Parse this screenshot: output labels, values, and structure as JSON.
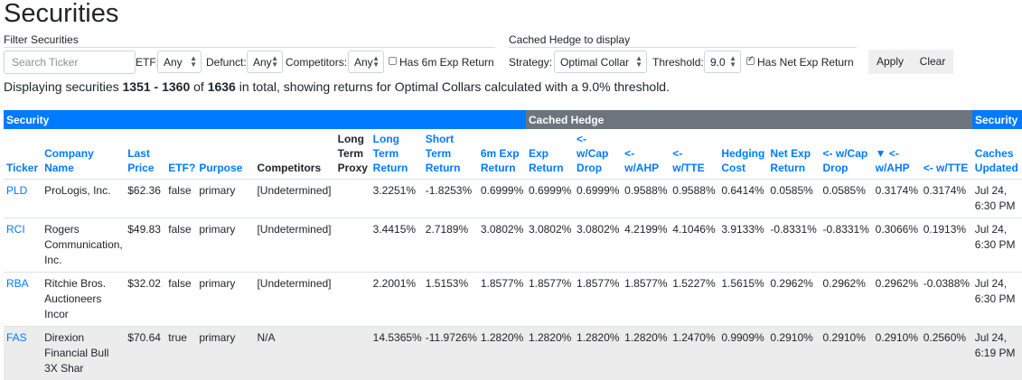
{
  "page_title": "Securities",
  "filter_legend": "Filter Securities",
  "hedge_legend": "Cached Hedge to display",
  "filters": {
    "search_placeholder": "Search Ticker",
    "etf_label": "ETF:",
    "etf_value": "Any",
    "defunct_label": "Defunct:",
    "defunct_value": "Any",
    "competitors_label": "Competitors:",
    "competitors_value": "Any",
    "has6m_label": "Has 6m Exp Return"
  },
  "hedge": {
    "strategy_label": "Strategy:",
    "strategy_value": "Optimal Collar",
    "threshold_label": "Threshold:",
    "threshold_value": "9.0",
    "net_exp_label": "Has Net Exp Return"
  },
  "buttons": {
    "apply": "Apply",
    "clear": "Clear"
  },
  "summary": {
    "prefix": "Displaying securities ",
    "range": "1351 - 1360",
    "of": " of ",
    "total": "1636",
    "suffix": " in total, showing returns for Optimal Collars calculated with a 9.0% threshold."
  },
  "groups": {
    "security": "Security",
    "cached_hedge": "Cached Hedge",
    "security_right": "Security"
  },
  "columns": [
    "Ticker",
    "Company Name",
    "Last Price",
    "ETF?",
    "Purpose",
    "Competitors",
    "Long Term Proxy",
    "Long Term Return",
    "Short Term Return",
    "6m Exp Return",
    "Exp Return",
    "<- w/Cap Drop",
    "<- w/AHP",
    "<- w/TTE",
    "Hedging Cost",
    "Net Exp Return",
    "<- w/Cap Drop",
    "▼ <- w/AHP",
    "<- w/TTE",
    "Caches Updated"
  ],
  "rows": [
    [
      "PLD",
      "ProLogis, Inc.",
      "$62.36",
      "false",
      "primary",
      "[Undetermined]",
      "",
      "3.2251%",
      "-1.8253%",
      "0.6999%",
      "0.6999%",
      "0.6999%",
      "0.9588%",
      "0.9588%",
      "0.6414%",
      "0.0585%",
      "0.0585%",
      "0.3174%",
      "0.3174%",
      "Jul 24, 6:30 PM"
    ],
    [
      "RCI",
      "Rogers Communication, Inc.",
      "$49.83",
      "false",
      "primary",
      "[Undetermined]",
      "",
      "3.4415%",
      "2.7189%",
      "3.0802%",
      "3.0802%",
      "3.0802%",
      "4.2199%",
      "4.1046%",
      "3.9133%",
      "-0.8331%",
      "-0.8331%",
      "0.3066%",
      "0.1913%",
      "Jul 24, 6:30 PM"
    ],
    [
      "RBA",
      "Ritchie Bros. Auctioneers Incor",
      "$32.02",
      "false",
      "primary",
      "[Undetermined]",
      "",
      "2.2001%",
      "1.5153%",
      "1.8577%",
      "1.8577%",
      "1.8577%",
      "1.8577%",
      "1.5227%",
      "1.5615%",
      "0.2962%",
      "0.2962%",
      "0.2962%",
      "-0.0388%",
      "Jul 24, 6:30 PM"
    ],
    [
      "FAS",
      "Direxion Financial Bull 3X Shar",
      "$70.64",
      "true",
      "primary",
      "N/A",
      "",
      "14.5365%",
      "-11.9726%",
      "1.2820%",
      "1.2820%",
      "1.2820%",
      "1.2820%",
      "1.2470%",
      "0.9909%",
      "0.2910%",
      "0.2910%",
      "0.2910%",
      "0.2560%",
      "Jul 24, 6:19 PM"
    ]
  ]
}
